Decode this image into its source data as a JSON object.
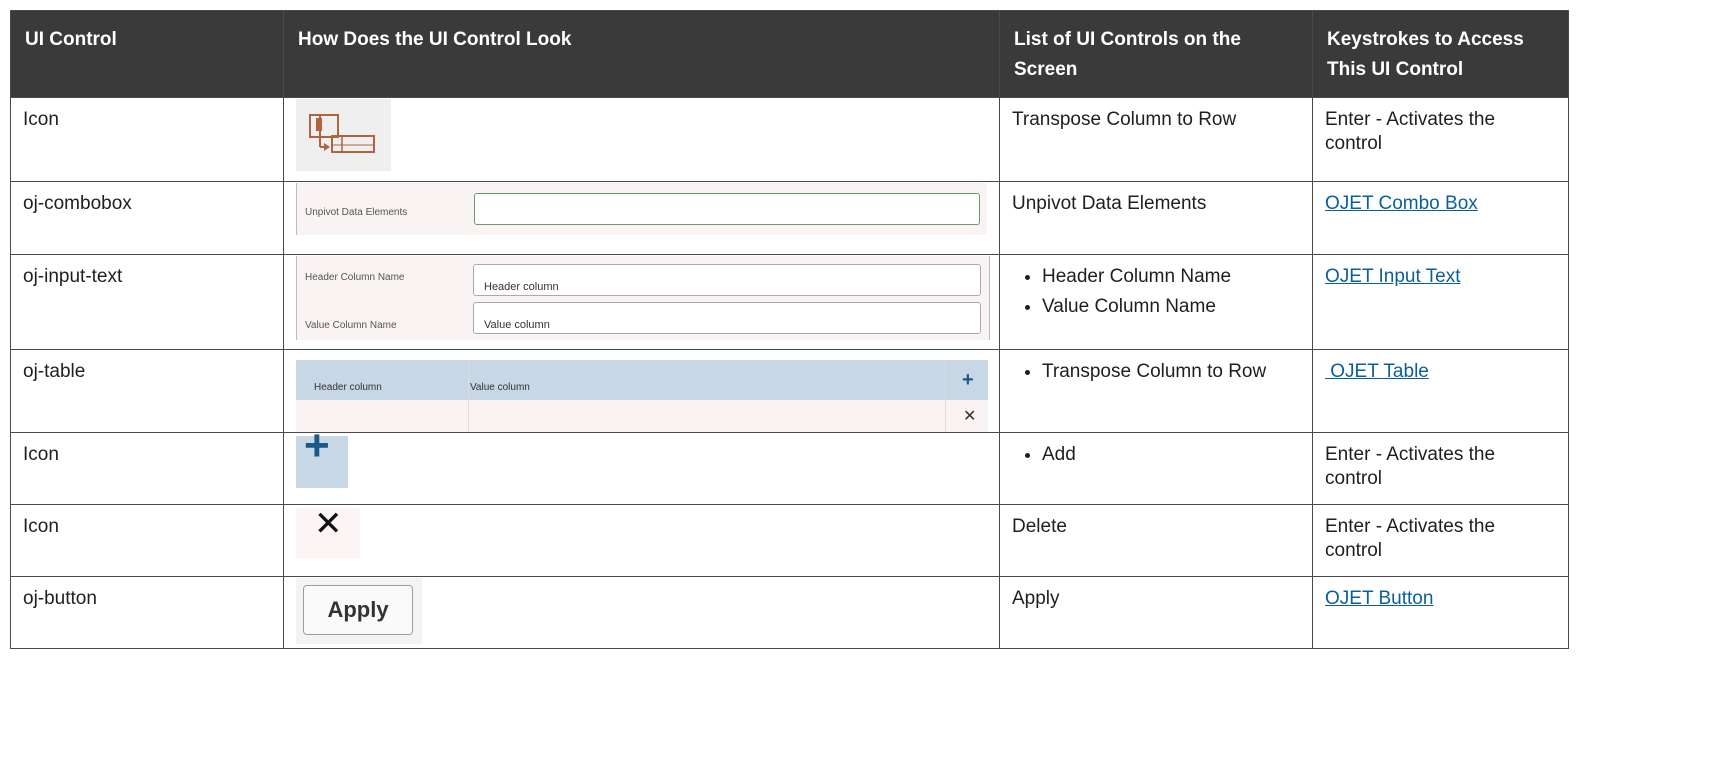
{
  "headers": {
    "ui_control": "UI Control",
    "look": "How Does the UI Control Look",
    "list": "List of UI Controls on the Screen",
    "keystrokes": "Keystrokes to Access This UI Control"
  },
  "rows": [
    {
      "control": "Icon",
      "preview_icon": "transpose-column-to-row-icon",
      "list_text": "Transpose Column to Row",
      "keys_text": "Enter - Activates the control"
    },
    {
      "control": "oj-combobox",
      "preview": {
        "label": "Unpivot Data Elements",
        "value": ""
      },
      "list_text": "Unpivot Data Elements",
      "keys_link": "OJET Combo Box"
    },
    {
      "control": "oj-input-text",
      "preview": {
        "fields": [
          {
            "label": "Header Column Name",
            "value": "Header column"
          },
          {
            "label": "Value Column Name",
            "value": "Value column"
          }
        ]
      },
      "list_items": [
        "Header Column Name",
        "Value Column Name"
      ],
      "keys_link": "OJET Input Text"
    },
    {
      "control": "oj-table",
      "preview": {
        "columns": [
          "Header column",
          "Value column"
        ],
        "add_icon": "plus-icon",
        "delete_icon": "close-icon"
      },
      "list_items": [
        "Transpose Column to Row"
      ],
      "keys_link": " OJET Table"
    },
    {
      "control": "Icon",
      "preview_icon": "plus-icon",
      "list_items": [
        "Add"
      ],
      "keys_text": "Enter - Activates the control"
    },
    {
      "control": "Icon",
      "preview_icon": "close-icon",
      "list_text": "Delete",
      "keys_text": "Enter - Activates the control"
    },
    {
      "control": "oj-button",
      "preview": {
        "button_label": "Apply"
      },
      "list_text": "Apply",
      "keys_link": "OJET Button"
    }
  ],
  "colors": {
    "header_bg": "#3a3a3a",
    "link": "#0b5f99",
    "accent_blue": "#1b5a86",
    "table_header_bg": "#c7d7e6"
  }
}
